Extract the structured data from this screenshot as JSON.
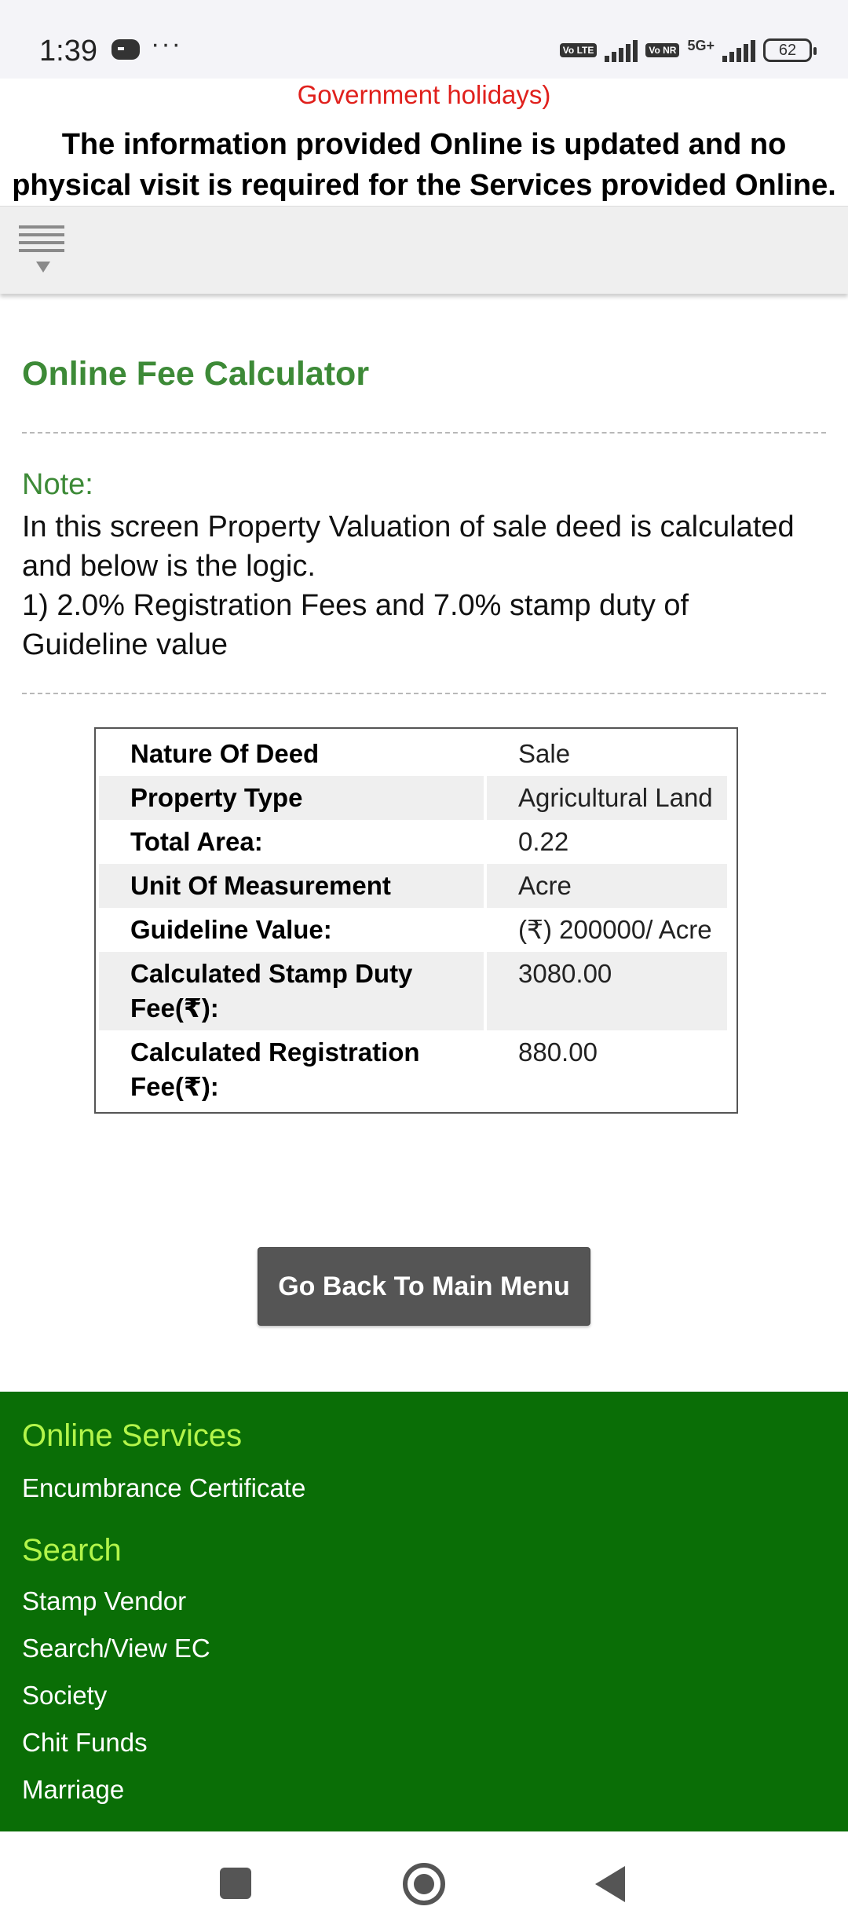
{
  "status_bar": {
    "time": "1:39",
    "more": "···",
    "volte1": "Vo LTE",
    "volte2": "Vo NR",
    "network": "5G+",
    "battery": "62"
  },
  "notice": {
    "red_text": "Government holidays)",
    "main_text": "The information provided Online is updated and no physical visit is required for the Services provided Online."
  },
  "page": {
    "title": "Online Fee Calculator",
    "note_label": "Note:",
    "note_line1": "In this screen Property Valuation of sale deed is calculated and below is the logic.",
    "note_line2": "1) 2.0% Registration Fees and 7.0% stamp duty of Guideline value"
  },
  "fee_table": [
    {
      "key": "Nature Of Deed",
      "value": "Sale"
    },
    {
      "key": "Property Type",
      "value": "Agricultural Land"
    },
    {
      "key": "Total Area:",
      "value": "0.22"
    },
    {
      "key": "Unit Of Measurement",
      "value": "Acre"
    },
    {
      "key": "Guideline Value:",
      "value": "(₹) 200000/ Acre"
    },
    {
      "key": "Calculated Stamp Duty Fee(₹):",
      "value": "3080.00"
    },
    {
      "key": "Calculated Registration Fee(₹):",
      "value": "880.00"
    }
  ],
  "back_button": "Go Back To Main Menu",
  "footer": {
    "online_services_heading": "Online Services",
    "online_services": [
      "Encumbrance Certificate"
    ],
    "search_heading": "Search",
    "search_links": [
      "Stamp Vendor",
      "Search/View EC",
      "Society",
      "Chit Funds",
      "Marriage"
    ]
  },
  "colors": {
    "accent_green": "#3d8a37",
    "footer_green": "#0a6e06",
    "footer_heading": "#b3f54a",
    "notice_red": "#e0201c",
    "button_gray": "#555555"
  },
  "icons": [
    "gamepad-icon",
    "signal-icon",
    "battery-icon",
    "menu-icon",
    "recents-icon",
    "home-icon",
    "back-icon"
  ]
}
